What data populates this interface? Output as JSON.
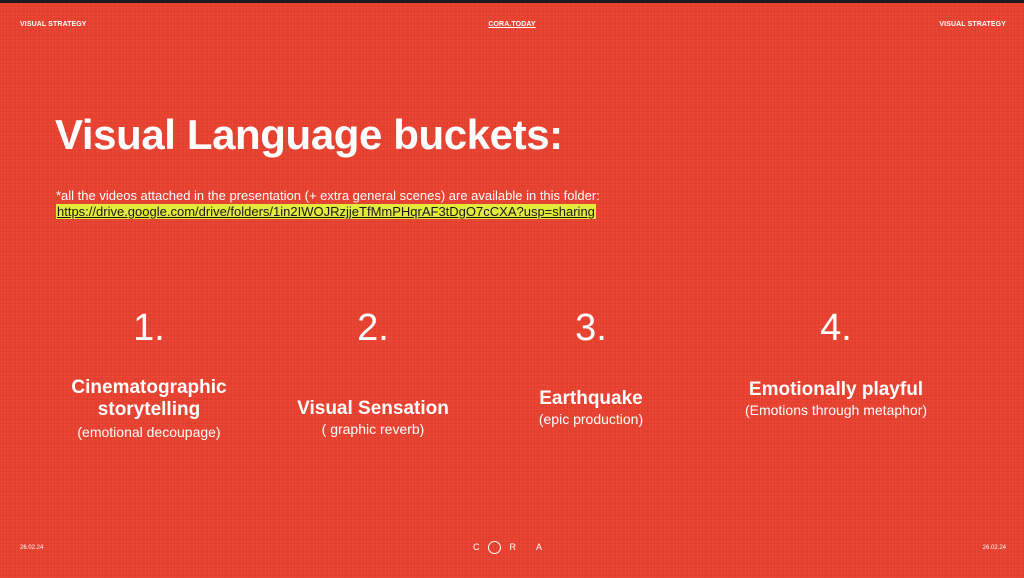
{
  "header": {
    "left": "VISUAL STRATEGY",
    "center": "CORA.TODAY",
    "right": "VISUAL STRATEGY"
  },
  "title": "Visual Language buckets:",
  "note": {
    "text": "*all the videos attached in the presentation  (+ extra general scenes) are available in this folder:",
    "link": "https://drive.google.com/drive/folders/1in2IWOJRzjjeTfMmPHqrAF3tDgO7cCXA?usp=sharing",
    "link_highlight_color": "#e2ea3c"
  },
  "buckets": [
    {
      "number": "1.",
      "label_line1": "Cinematographic",
      "label_line2": "storytelling",
      "subtitle": "(emotional decoupage)"
    },
    {
      "number": "2.",
      "label_line1": "Visual Sensation",
      "label_line2": "",
      "subtitle": "( graphic reverb)"
    },
    {
      "number": "3.",
      "label_line1": "Earthquake",
      "label_line2": "",
      "subtitle": "(epic production)"
    },
    {
      "number": "4.",
      "label_line1": "Emotionally playful",
      "label_line2": "",
      "subtitle": "(Emotions through metaphor)"
    }
  ],
  "footer": {
    "left_date": "26.02.24",
    "logo_left": "C",
    "logo_right": "R A",
    "right_date": "26.02.24"
  },
  "colors": {
    "background": "#e8402e",
    "text": "#ffffff"
  }
}
